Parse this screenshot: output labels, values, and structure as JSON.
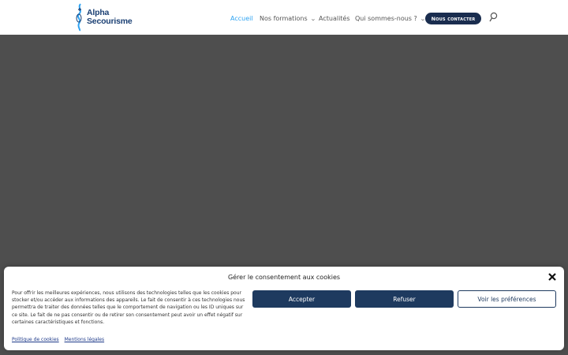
{
  "header": {
    "logo_line1": "Alpha",
    "logo_line2": "Secourisme",
    "nav": [
      {
        "label": "Accueil",
        "active": true,
        "dropdown": false
      },
      {
        "label": "Nos formations",
        "active": false,
        "dropdown": true
      },
      {
        "label": "Actualités",
        "active": false,
        "dropdown": false
      },
      {
        "label": "Qui sommes-nous ?",
        "active": false,
        "dropdown": true
      }
    ],
    "cta_label": "Nous contacter",
    "search_icon": "search-icon",
    "chevron_icon": "chevron-down-icon"
  },
  "hero": {
    "background": "#4e4e4e"
  },
  "cookie": {
    "title": "Gérer le consentement aux cookies",
    "text": "Pour offrir les meilleures expériences, nous utilisons des technologies telles que les cookies pour stocker et/ou accéder aux informations des appareils. Le fait de consentir à ces technologies nous permettra de traiter des données telles que le comportement de navigation ou les ID uniques sur ce site. Le fait de ne pas consentir ou de retirer son consentement peut avoir un effet négatif sur certaines caractéristiques et fonctions.",
    "accept_label": "Accepter",
    "refuse_label": "Refuser",
    "prefs_label": "Voir les préférences",
    "policy_link": "Politique de cookies",
    "legal_link": "Mentions légales",
    "close_icon": "close-icon"
  },
  "colors": {
    "accent": "#2ea3f2",
    "brand": "#1e3a5f",
    "hero": "#4e4e4e"
  }
}
